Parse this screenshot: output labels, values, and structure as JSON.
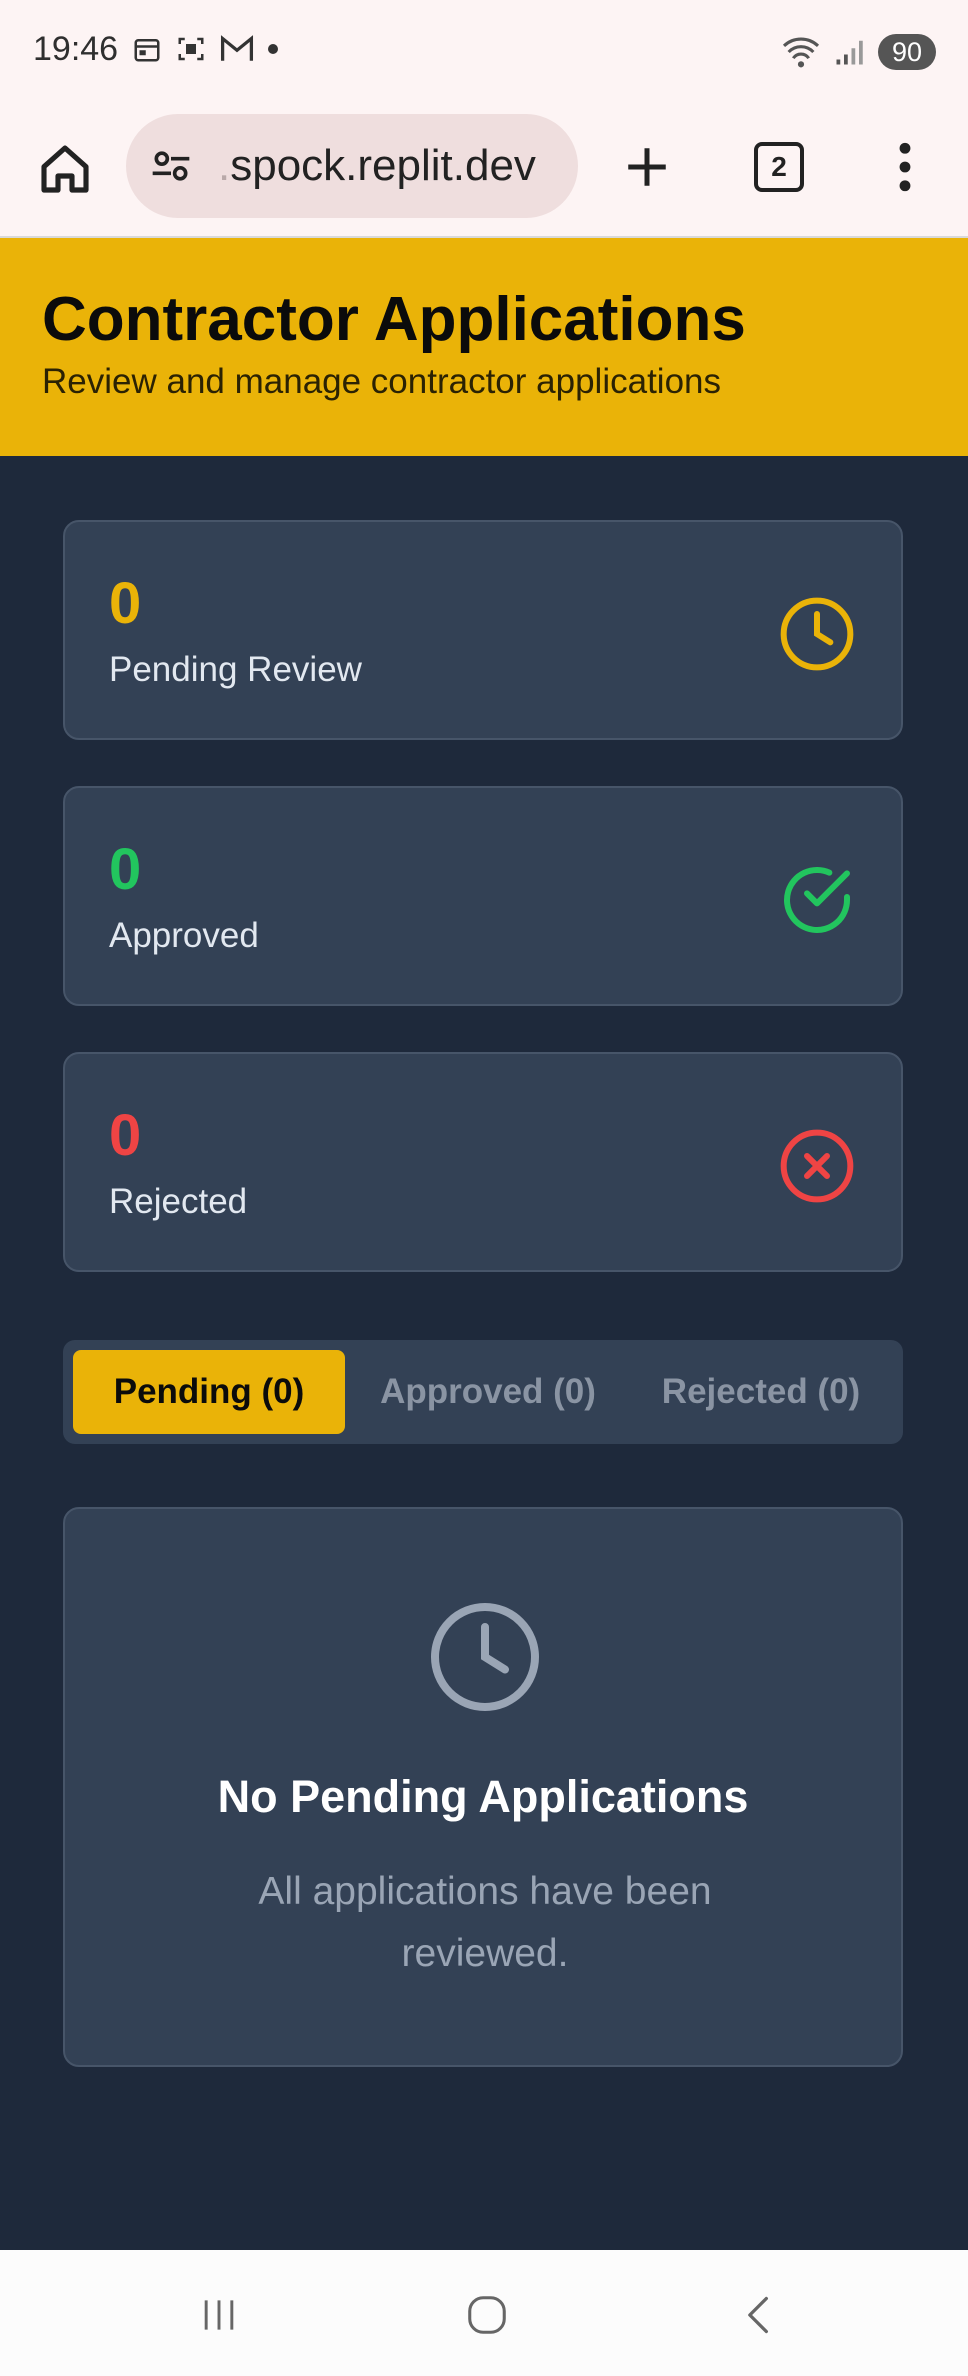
{
  "status_bar": {
    "time": "19:46",
    "battery": "90"
  },
  "browser": {
    "url_prefix": ".",
    "url": "spock.replit.dev",
    "tab_count": "2"
  },
  "header": {
    "title": "Contractor Applications",
    "subtitle": "Review and manage contractor applications"
  },
  "stats": [
    {
      "value": "0",
      "label": "Pending Review",
      "color": "#eab308",
      "icon": "clock-icon"
    },
    {
      "value": "0",
      "label": "Approved",
      "color": "#22c55e",
      "icon": "check-circle-icon"
    },
    {
      "value": "0",
      "label": "Rejected",
      "color": "#ef4444",
      "icon": "x-circle-icon"
    }
  ],
  "tabs": [
    {
      "label": "Pending (0)",
      "active": true
    },
    {
      "label": "Approved (0)",
      "active": false
    },
    {
      "label": "Rejected (0)",
      "active": false
    }
  ],
  "empty_state": {
    "icon": "clock-icon",
    "title": "No Pending Applications",
    "message": "All applications have been reviewed."
  },
  "colors": {
    "accent": "#eab308",
    "background": "#1e293b",
    "card": "#334155"
  }
}
